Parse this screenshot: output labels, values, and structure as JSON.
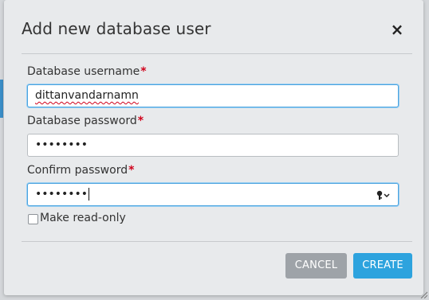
{
  "dialog": {
    "title": "Add new database user",
    "close_label": "×"
  },
  "fields": {
    "username": {
      "label": "Database username",
      "required_mark": "*",
      "value": "dittanvandarnamn"
    },
    "password": {
      "label": "Database password",
      "required_mark": "*",
      "value": "••••••••"
    },
    "confirm": {
      "label": "Confirm password",
      "required_mark": "*",
      "value": "••••••••"
    }
  },
  "readonly": {
    "label": "Make read-only",
    "checked": false
  },
  "buttons": {
    "cancel": "CANCEL",
    "create": "CREATE"
  },
  "colors": {
    "accent": "#2da3de",
    "cancel": "#9ea3a8",
    "required": "#d0021b"
  },
  "icons": {
    "close": "close-icon",
    "password_manager": "key-icon"
  }
}
